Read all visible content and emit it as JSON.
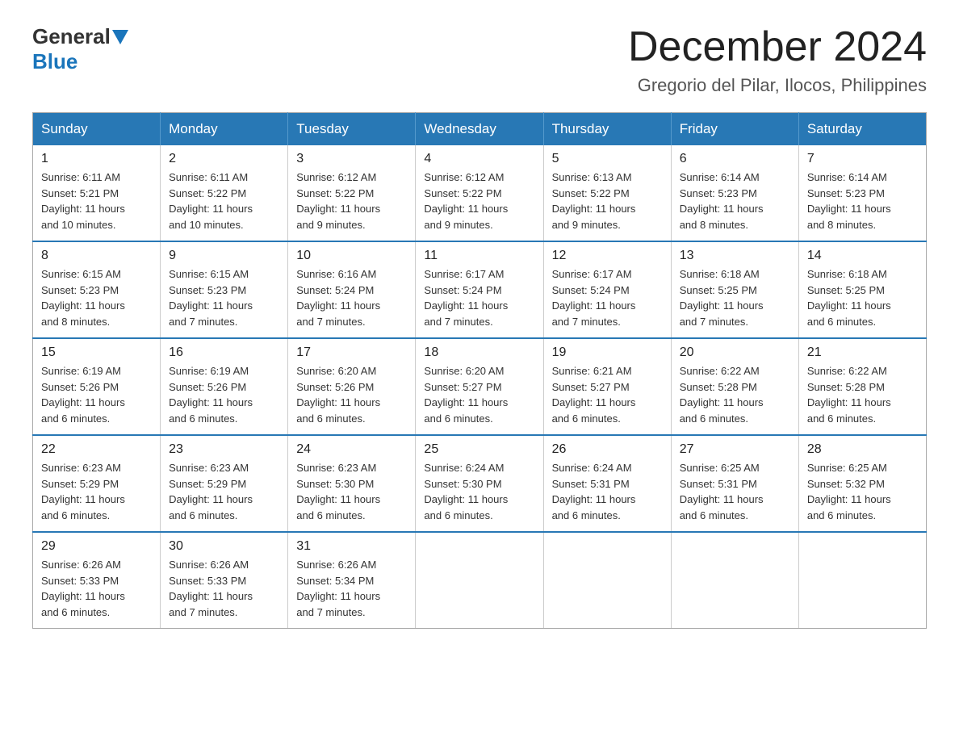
{
  "logo": {
    "general": "General",
    "blue": "Blue"
  },
  "title": "December 2024",
  "subtitle": "Gregorio del Pilar, Ilocos, Philippines",
  "days_of_week": [
    "Sunday",
    "Monday",
    "Tuesday",
    "Wednesday",
    "Thursday",
    "Friday",
    "Saturday"
  ],
  "weeks": [
    [
      {
        "day": "1",
        "sunrise": "6:11 AM",
        "sunset": "5:21 PM",
        "daylight": "11 hours and 10 minutes."
      },
      {
        "day": "2",
        "sunrise": "6:11 AM",
        "sunset": "5:22 PM",
        "daylight": "11 hours and 10 minutes."
      },
      {
        "day": "3",
        "sunrise": "6:12 AM",
        "sunset": "5:22 PM",
        "daylight": "11 hours and 9 minutes."
      },
      {
        "day": "4",
        "sunrise": "6:12 AM",
        "sunset": "5:22 PM",
        "daylight": "11 hours and 9 minutes."
      },
      {
        "day": "5",
        "sunrise": "6:13 AM",
        "sunset": "5:22 PM",
        "daylight": "11 hours and 9 minutes."
      },
      {
        "day": "6",
        "sunrise": "6:14 AM",
        "sunset": "5:23 PM",
        "daylight": "11 hours and 8 minutes."
      },
      {
        "day": "7",
        "sunrise": "6:14 AM",
        "sunset": "5:23 PM",
        "daylight": "11 hours and 8 minutes."
      }
    ],
    [
      {
        "day": "8",
        "sunrise": "6:15 AM",
        "sunset": "5:23 PM",
        "daylight": "11 hours and 8 minutes."
      },
      {
        "day": "9",
        "sunrise": "6:15 AM",
        "sunset": "5:23 PM",
        "daylight": "11 hours and 7 minutes."
      },
      {
        "day": "10",
        "sunrise": "6:16 AM",
        "sunset": "5:24 PM",
        "daylight": "11 hours and 7 minutes."
      },
      {
        "day": "11",
        "sunrise": "6:17 AM",
        "sunset": "5:24 PM",
        "daylight": "11 hours and 7 minutes."
      },
      {
        "day": "12",
        "sunrise": "6:17 AM",
        "sunset": "5:24 PM",
        "daylight": "11 hours and 7 minutes."
      },
      {
        "day": "13",
        "sunrise": "6:18 AM",
        "sunset": "5:25 PM",
        "daylight": "11 hours and 7 minutes."
      },
      {
        "day": "14",
        "sunrise": "6:18 AM",
        "sunset": "5:25 PM",
        "daylight": "11 hours and 6 minutes."
      }
    ],
    [
      {
        "day": "15",
        "sunrise": "6:19 AM",
        "sunset": "5:26 PM",
        "daylight": "11 hours and 6 minutes."
      },
      {
        "day": "16",
        "sunrise": "6:19 AM",
        "sunset": "5:26 PM",
        "daylight": "11 hours and 6 minutes."
      },
      {
        "day": "17",
        "sunrise": "6:20 AM",
        "sunset": "5:26 PM",
        "daylight": "11 hours and 6 minutes."
      },
      {
        "day": "18",
        "sunrise": "6:20 AM",
        "sunset": "5:27 PM",
        "daylight": "11 hours and 6 minutes."
      },
      {
        "day": "19",
        "sunrise": "6:21 AM",
        "sunset": "5:27 PM",
        "daylight": "11 hours and 6 minutes."
      },
      {
        "day": "20",
        "sunrise": "6:22 AM",
        "sunset": "5:28 PM",
        "daylight": "11 hours and 6 minutes."
      },
      {
        "day": "21",
        "sunrise": "6:22 AM",
        "sunset": "5:28 PM",
        "daylight": "11 hours and 6 minutes."
      }
    ],
    [
      {
        "day": "22",
        "sunrise": "6:23 AM",
        "sunset": "5:29 PM",
        "daylight": "11 hours and 6 minutes."
      },
      {
        "day": "23",
        "sunrise": "6:23 AM",
        "sunset": "5:29 PM",
        "daylight": "11 hours and 6 minutes."
      },
      {
        "day": "24",
        "sunrise": "6:23 AM",
        "sunset": "5:30 PM",
        "daylight": "11 hours and 6 minutes."
      },
      {
        "day": "25",
        "sunrise": "6:24 AM",
        "sunset": "5:30 PM",
        "daylight": "11 hours and 6 minutes."
      },
      {
        "day": "26",
        "sunrise": "6:24 AM",
        "sunset": "5:31 PM",
        "daylight": "11 hours and 6 minutes."
      },
      {
        "day": "27",
        "sunrise": "6:25 AM",
        "sunset": "5:31 PM",
        "daylight": "11 hours and 6 minutes."
      },
      {
        "day": "28",
        "sunrise": "6:25 AM",
        "sunset": "5:32 PM",
        "daylight": "11 hours and 6 minutes."
      }
    ],
    [
      {
        "day": "29",
        "sunrise": "6:26 AM",
        "sunset": "5:33 PM",
        "daylight": "11 hours and 6 minutes."
      },
      {
        "day": "30",
        "sunrise": "6:26 AM",
        "sunset": "5:33 PM",
        "daylight": "11 hours and 7 minutes."
      },
      {
        "day": "31",
        "sunrise": "6:26 AM",
        "sunset": "5:34 PM",
        "daylight": "11 hours and 7 minutes."
      },
      null,
      null,
      null,
      null
    ]
  ],
  "labels": {
    "sunrise": "Sunrise:",
    "sunset": "Sunset:",
    "daylight": "Daylight:"
  }
}
